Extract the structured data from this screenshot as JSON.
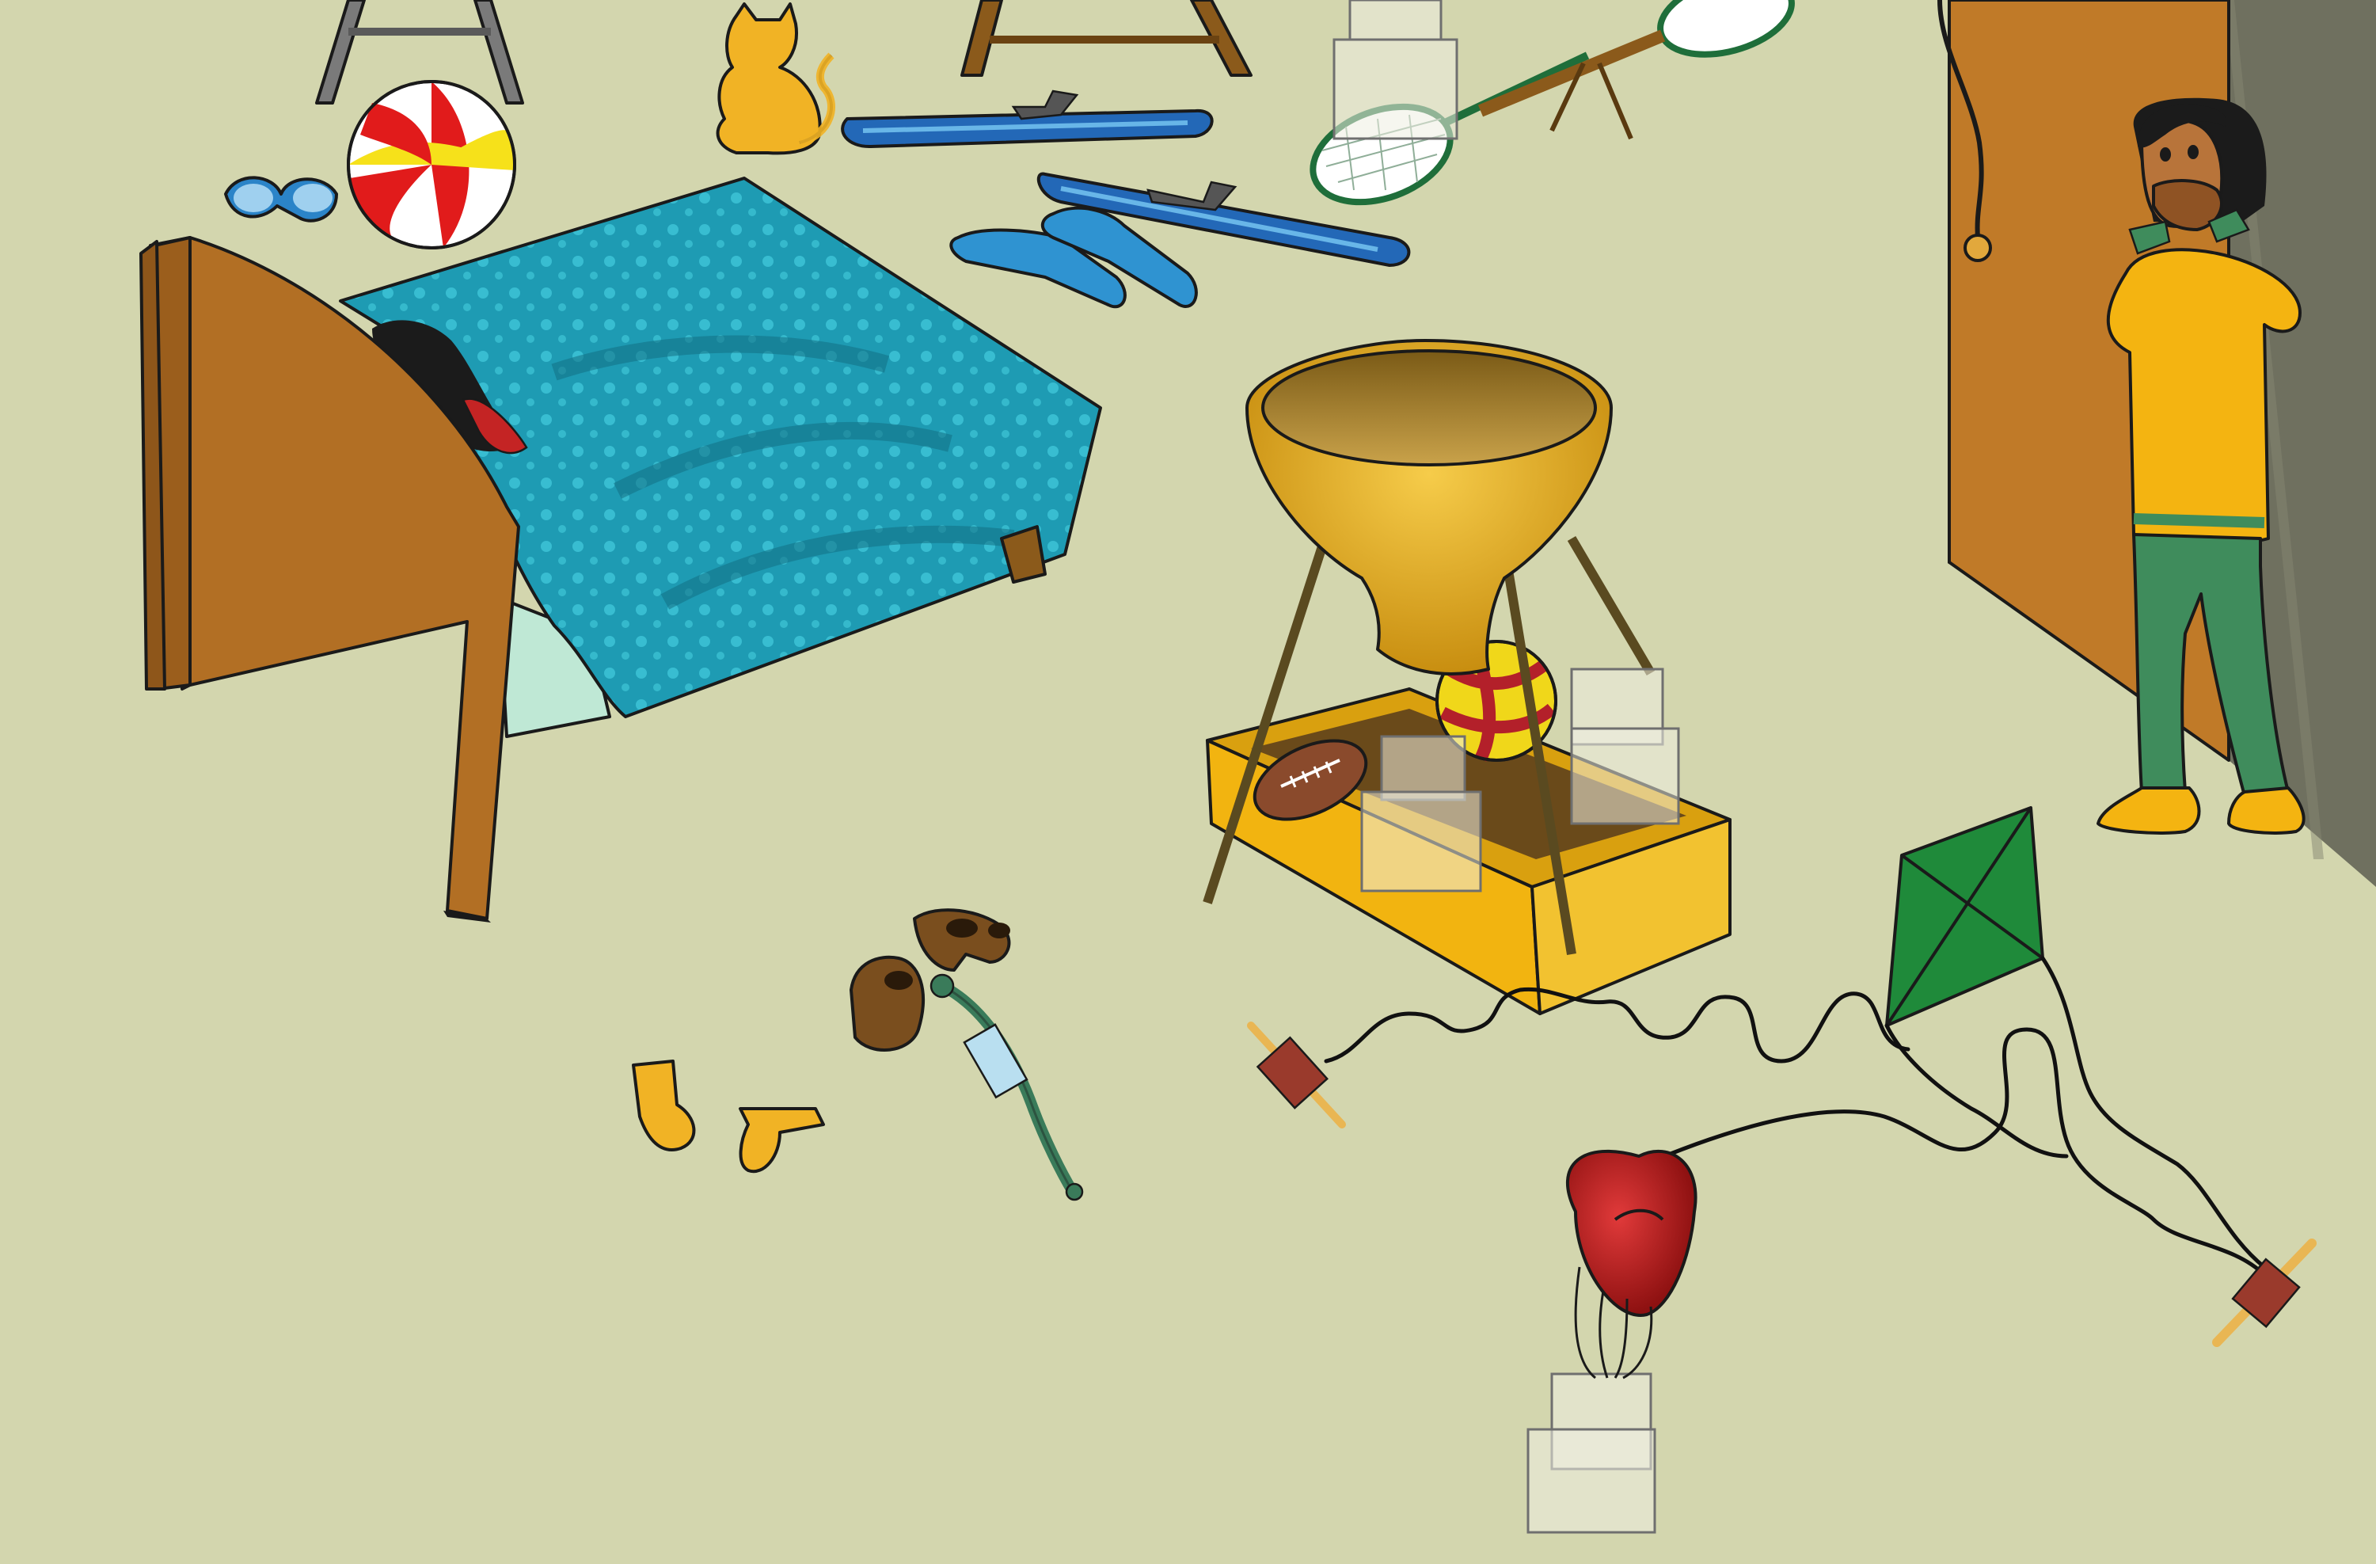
{
  "scene": {
    "colors": {
      "floor": "#d3d6ae",
      "wall_shadow": "#6f705f",
      "door": "#c07a28",
      "blanket": "#1e9bb3",
      "headboard": "#b26f24",
      "bowl_gold": "#e7aa1c",
      "tray": "#f2b410",
      "kite": "#1f8a3a",
      "shirt": "#f4b411",
      "pants": "#3f8c5c",
      "cap_red": "#b31d1d",
      "overlay_box": "#efefe2"
    },
    "objects": [
      "bed",
      "sleeping-child",
      "blanket",
      "beach-ball",
      "swim-goggles",
      "cat",
      "skis",
      "flippers",
      "badminton-rackets",
      "standing-lamp-bowl",
      "yellow-tray",
      "american-football",
      "volleyball",
      "boots",
      "hose-nozzle",
      "socks",
      "kite",
      "string-spool",
      "red-cap",
      "door",
      "child-calling",
      "easel-legs"
    ],
    "interactive_boxes": 7
  }
}
